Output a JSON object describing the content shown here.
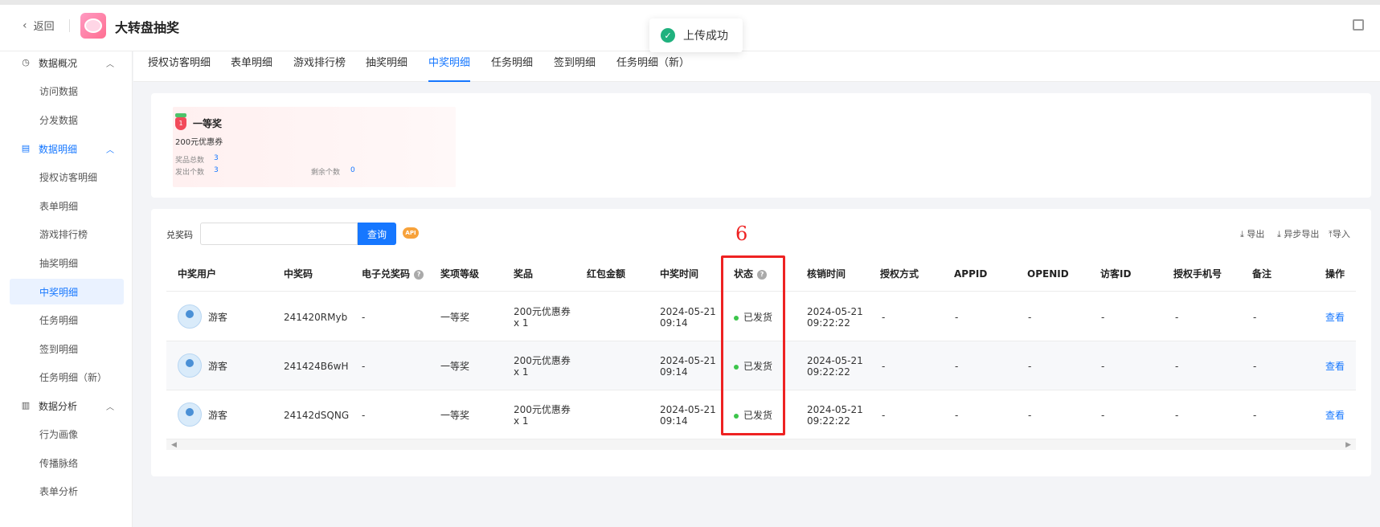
{
  "header": {
    "back_label": "返回",
    "app_title": "大转盘抽奖"
  },
  "toast": {
    "message": "上传成功"
  },
  "sidebar": {
    "groups": [
      {
        "label": "数据概况",
        "icon": "clock-icon",
        "items": [
          "访问数据",
          "分发数据"
        ]
      },
      {
        "label": "数据明细",
        "icon": "document-icon",
        "items": [
          "授权访客明细",
          "表单明细",
          "游戏排行榜",
          "抽奖明细",
          "中奖明细",
          "任务明细",
          "签到明细",
          "任务明细（新）"
        ]
      },
      {
        "label": "数据分析",
        "icon": "bar-chart-icon",
        "items": [
          "行为画像",
          "传播脉络",
          "表单分析"
        ]
      }
    ],
    "active_item": "中奖明细"
  },
  "tabs": [
    "授权访客明细",
    "表单明细",
    "游戏排行榜",
    "抽奖明细",
    "中奖明细",
    "任务明细",
    "签到明细",
    "任务明细（新）"
  ],
  "active_tab": "中奖明细",
  "prize_card": {
    "rank": "1",
    "name": "一等奖",
    "desc": "200元优惠券",
    "total_label": "奖品总数",
    "total_value": "3",
    "issued_label": "发出个数",
    "issued_value": "3",
    "remain_label": "剩余个数",
    "remain_value": "0"
  },
  "filter": {
    "label": "兑奖码",
    "input_value": "",
    "query_button": "查询",
    "api_badge": "API"
  },
  "toolbar": {
    "export": "导出",
    "async_export": "异步导出",
    "import": "导入"
  },
  "table": {
    "columns": [
      "中奖用户",
      "中奖码",
      "电子兑奖码",
      "奖项等级",
      "奖品",
      "红包金额",
      "中奖时间",
      "状态",
      "核销时间",
      "授权方式",
      "APPID",
      "OPENID",
      "访客ID",
      "授权手机号",
      "备注",
      "操作"
    ],
    "rows": [
      {
        "user": "游客",
        "code": "241420RMyb",
        "ecode": "-",
        "level": "一等奖",
        "prize_line1": "200元优惠券",
        "prize_line2": "x 1",
        "time_line1": "2024-05-21",
        "time_line2": "09:14",
        "status": "已发货",
        "redeem_line1": "2024-05-21",
        "redeem_line2": "09:22:22",
        "auth": "-",
        "appid": "-",
        "openid": "-",
        "visitor": "-",
        "phone": "-",
        "note": "-",
        "action": "查看"
      },
      {
        "user": "游客",
        "code": "241424B6wH",
        "ecode": "-",
        "level": "一等奖",
        "prize_line1": "200元优惠券",
        "prize_line2": "x 1",
        "time_line1": "2024-05-21",
        "time_line2": "09:14",
        "status": "已发货",
        "redeem_line1": "2024-05-21",
        "redeem_line2": "09:22:22",
        "auth": "-",
        "appid": "-",
        "openid": "-",
        "visitor": "-",
        "phone": "-",
        "note": "-",
        "action": "查看"
      },
      {
        "user": "游客",
        "code": "24142dSQNG",
        "ecode": "-",
        "level": "一等奖",
        "prize_line1": "200元优惠券",
        "prize_line2": "x 1",
        "time_line1": "2024-05-21",
        "time_line2": "09:14",
        "status": "已发货",
        "redeem_line1": "2024-05-21",
        "redeem_line2": "09:22:22",
        "auth": "-",
        "appid": "-",
        "openid": "-",
        "visitor": "-",
        "phone": "-",
        "note": "-",
        "action": "查看"
      }
    ]
  },
  "annotation": {
    "label": "6",
    "color": "#e22222"
  },
  "colors": {
    "accent": "#1677ff",
    "status_ok": "#3cc54b",
    "toast_ok": "#20b17e"
  }
}
